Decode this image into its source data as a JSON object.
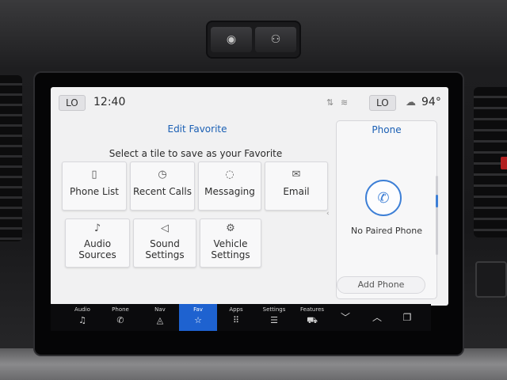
{
  "status_bar": {
    "left_lo": "LO",
    "time": "12:40",
    "right_lo": "LO",
    "temperature": "94°",
    "icons": [
      "sync-arrows-icon",
      "wifi-icon",
      "weather-cloud-icon"
    ]
  },
  "edit_favorite": {
    "title": "Edit Favorite",
    "subtitle": "Select a tile to save as your Favorite",
    "tiles": [
      {
        "label": "Phone List",
        "icon": "phone-list-icon"
      },
      {
        "label": "Recent Calls",
        "icon": "clock-icon"
      },
      {
        "label": "Messaging",
        "icon": "chat-bubbles-icon"
      },
      {
        "label": "Email",
        "icon": "envelope-icon"
      },
      {
        "label": "Audio Sources",
        "icon": "audio-sources-icon"
      },
      {
        "label": "Sound Settings",
        "icon": "speaker-icon"
      },
      {
        "label": "Vehicle Settings",
        "icon": "vehicle-settings-icon"
      }
    ]
  },
  "phone_panel": {
    "title": "Phone",
    "status": "No Paired Phone",
    "add_phone": "Add Phone"
  },
  "dock": {
    "items": [
      {
        "label": "Audio",
        "icon": "music-note-icon"
      },
      {
        "label": "Phone",
        "icon": "phone-icon"
      },
      {
        "label": "Nav",
        "icon": "navigation-icon"
      },
      {
        "label": "Fav",
        "icon": "star-icon",
        "active": true
      },
      {
        "label": "Apps",
        "icon": "apps-grid-icon"
      },
      {
        "label": "Settings",
        "icon": "settings-sliders-icon"
      },
      {
        "label": "Features",
        "icon": "truck-icon"
      },
      {
        "label": "",
        "icon": "chevron-down-icon"
      },
      {
        "label": "",
        "icon": "chevron-up-icon"
      },
      {
        "label": "",
        "icon": "overlap-squares-icon"
      }
    ]
  },
  "colors": {
    "accent": "#1a5fb4",
    "dock_active": "#1e62d0",
    "screen_bg": "#f1f1f2"
  }
}
